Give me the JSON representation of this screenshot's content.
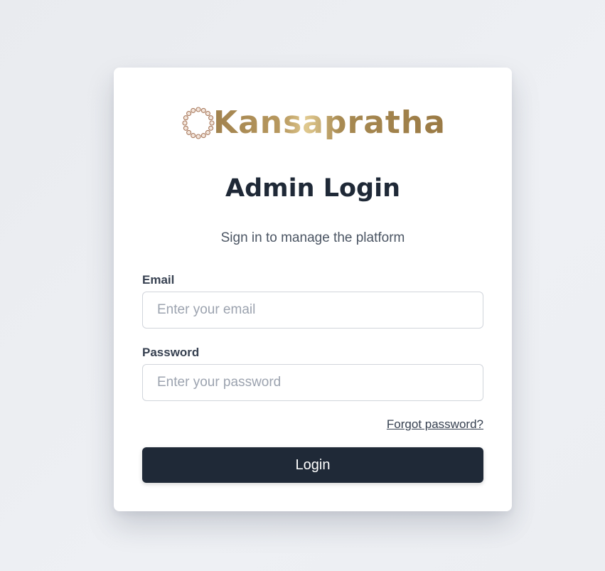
{
  "brand": {
    "name": "Kansapratha",
    "logo_icon": "beaded-ring-icon",
    "color": "#a1824e"
  },
  "login": {
    "title": "Admin Login",
    "subtitle": "Sign in to manage the platform",
    "email_label": "Email",
    "email_placeholder": "Enter your email",
    "email_value": "",
    "password_label": "Password",
    "password_placeholder": "Enter your password",
    "password_value": "",
    "forgot_label": "Forgot password?",
    "submit_label": "Login"
  },
  "colors": {
    "button_bg": "#1f2937",
    "title": "#1f2937",
    "page_bg": "#eceef2"
  }
}
